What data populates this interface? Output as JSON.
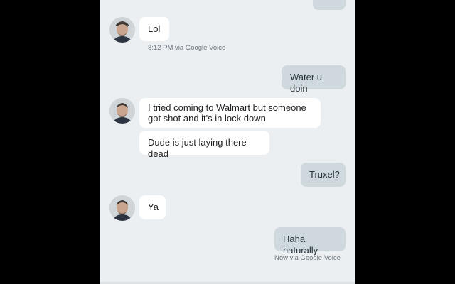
{
  "conversation": {
    "messages": [
      {
        "text": "Lol"
      },
      {
        "text": "Water u doin"
      },
      {
        "text": "I tried coming to Walmart but someone got shot and it's in lock down"
      },
      {
        "text": "Dude is just laying there dead"
      },
      {
        "text": "Truxel?"
      },
      {
        "text": "Ya"
      },
      {
        "text": "Haha naturally"
      }
    ],
    "meta": [
      {
        "text": "8:12 PM via Google Voice"
      },
      {
        "text": "Now via Google Voice"
      }
    ],
    "contact": {
      "avatar_icon": "contact-avatar"
    }
  },
  "colors": {
    "background": "#eceff1",
    "incoming_bubble": "#ffffff",
    "outgoing_bubble": "#cfd8dc",
    "letterbox": "#000000"
  }
}
